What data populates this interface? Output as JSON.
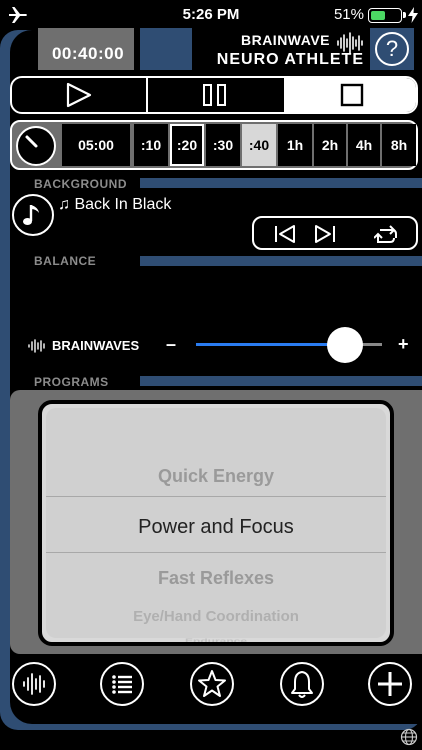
{
  "status": {
    "time": "5:26 PM",
    "battery": "51%",
    "battery_level": 0.51
  },
  "timer": "00:40:00",
  "brand": {
    "line1": "BRAINWAVE",
    "line2": "NEURO ATHLETE"
  },
  "help": "?",
  "durations": {
    "custom": "05:00",
    "items": [
      ":10",
      ":20",
      ":30",
      ":40",
      "1h",
      "2h",
      "4h",
      "8h"
    ],
    "selected": ":20",
    "highlighted": ":40"
  },
  "sections": {
    "background": "BACKGROUND",
    "balance": "BALANCE",
    "programs": "PROGRAMS"
  },
  "track": {
    "title": "Back In Black"
  },
  "balance": {
    "label": "BRAINWAVES",
    "minus": "–",
    "plus": "+",
    "value": 0.8
  },
  "programs": {
    "items": [
      "Quick Energy",
      "Power and Focus",
      "Fast Reflexes",
      "Eye/Hand Coordination",
      "Endurance"
    ],
    "selected": "Power and Focus"
  },
  "tabs": [
    "brainwave-icon",
    "list-icon",
    "star-icon",
    "bell-icon",
    "plus-icon"
  ],
  "colors": {
    "accent_blue": "#2f4d73",
    "slider_blue": "#2a7cf0",
    "battery_green": "#4cd964"
  }
}
